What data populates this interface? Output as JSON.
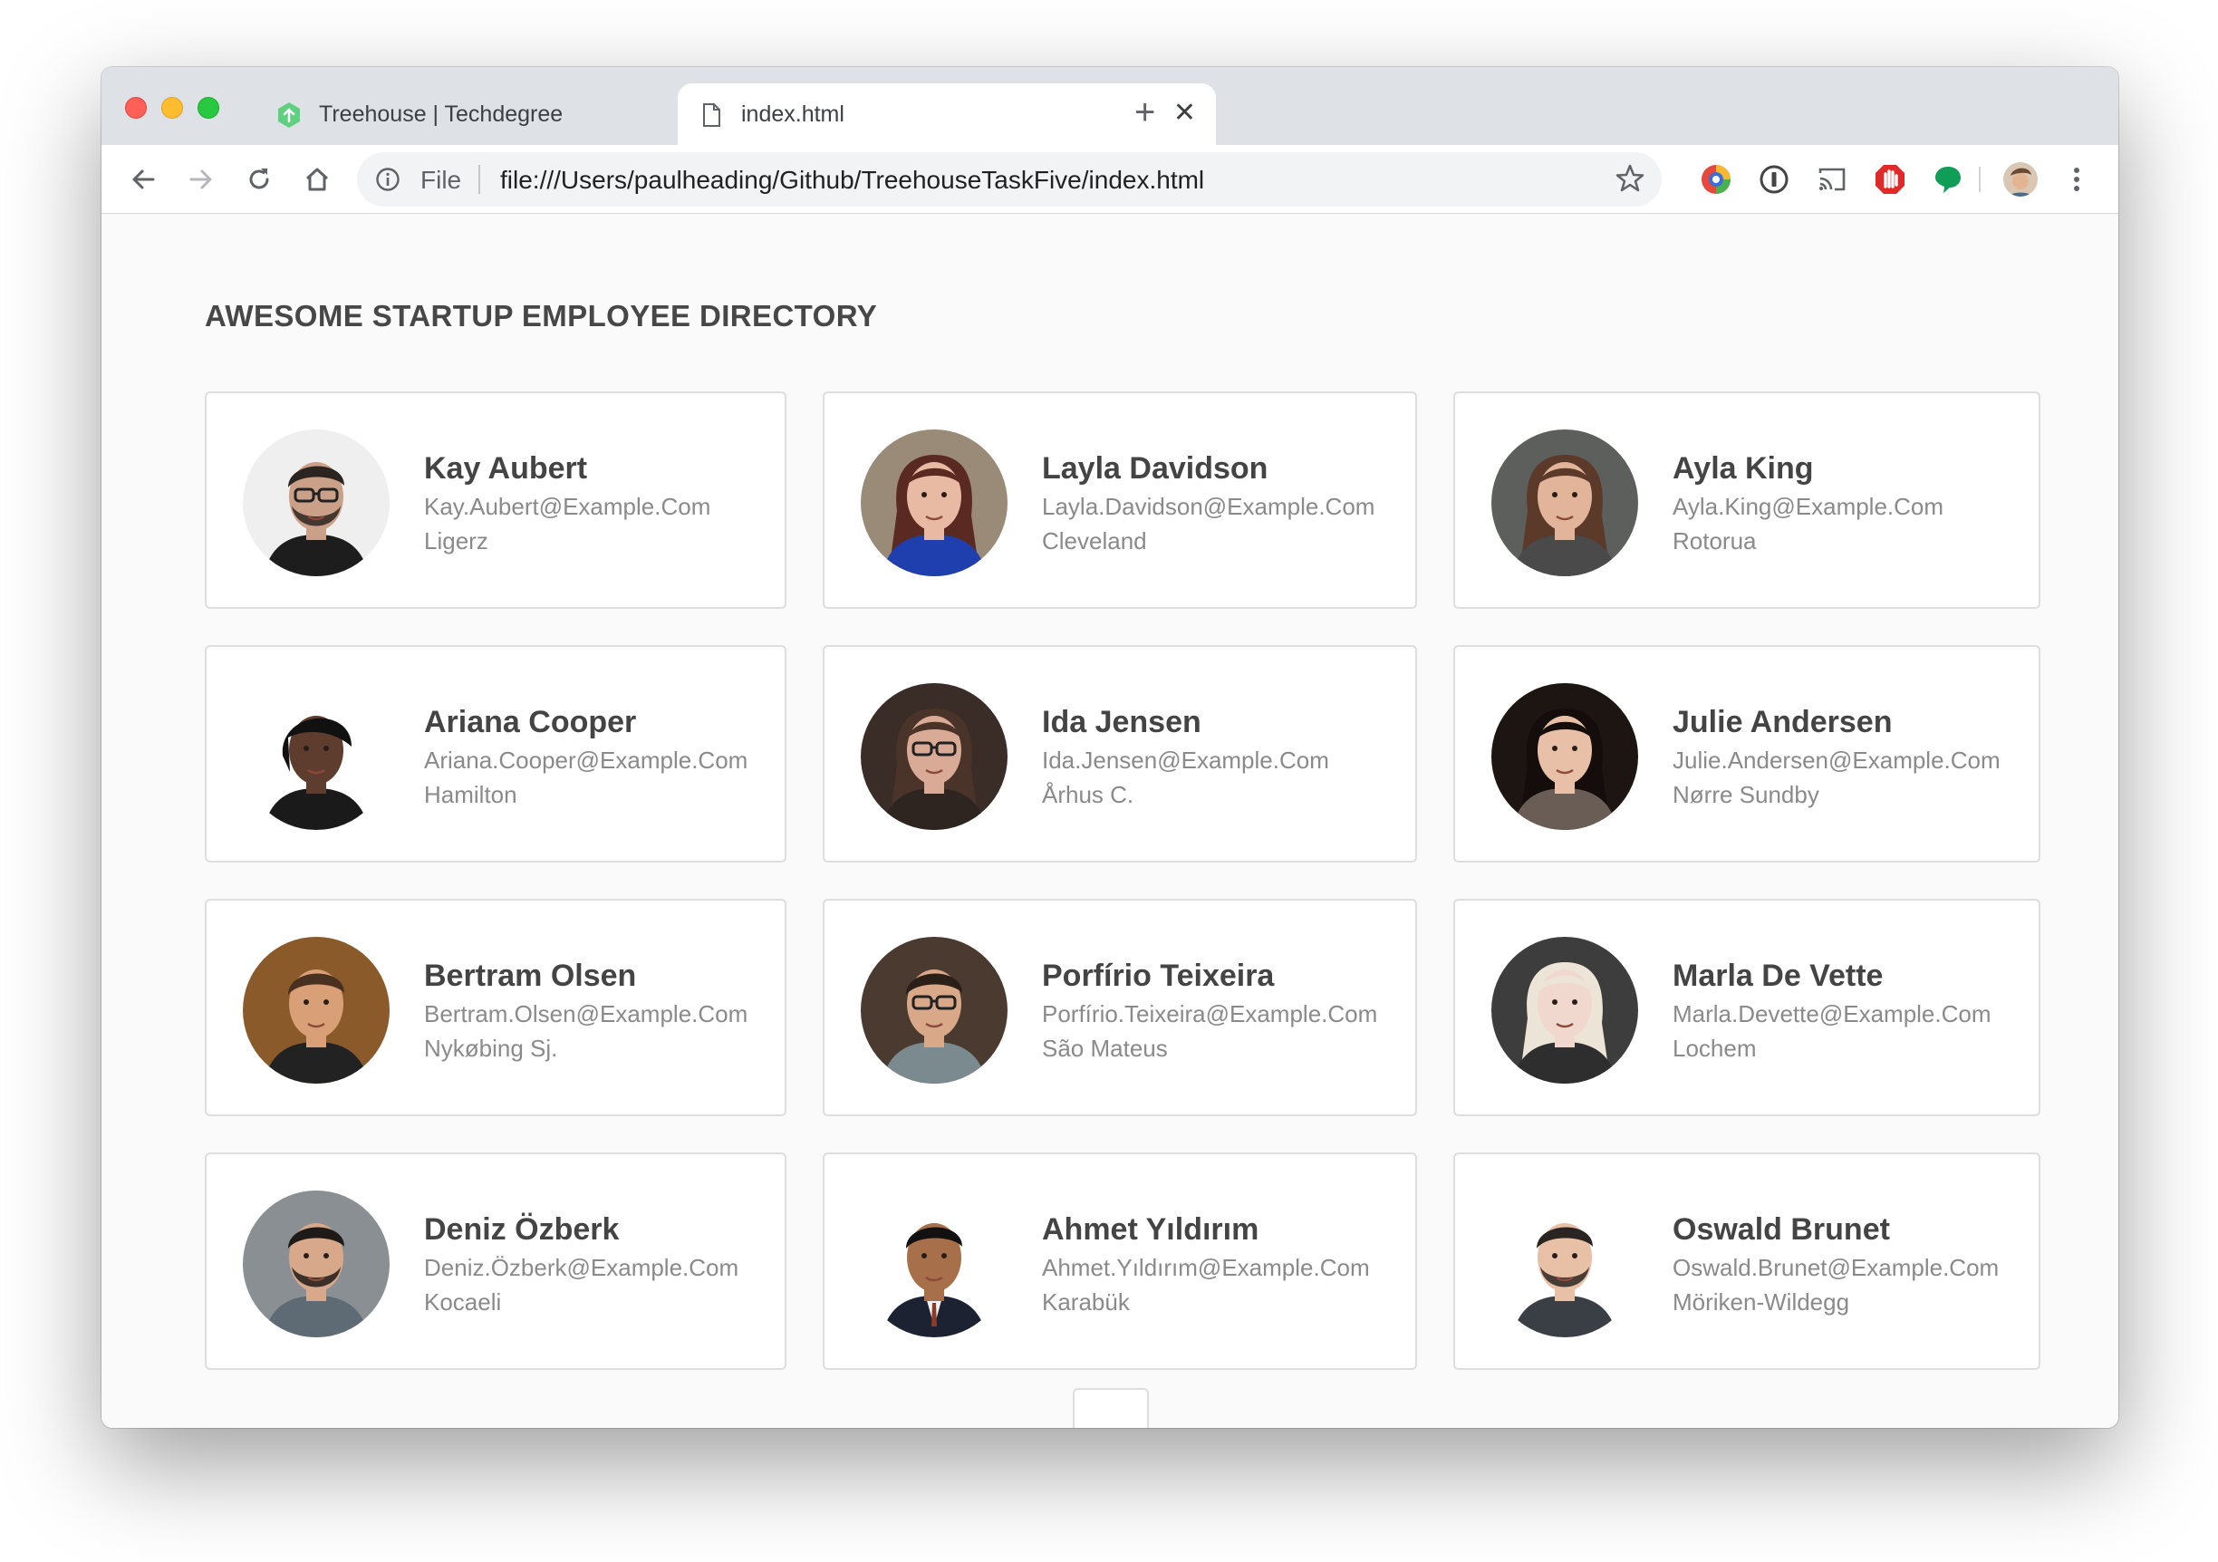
{
  "browser": {
    "tabs": [
      {
        "title": "Treehouse | Techdegree",
        "active": false,
        "icon": "treehouse-favicon"
      },
      {
        "title": "index.html",
        "active": true,
        "icon": "page-icon"
      }
    ],
    "close_glyph": "✕",
    "new_tab_glyph": "+",
    "address": {
      "scheme_label": "File",
      "url": "file:///Users/paulheading/Github/TreehouseTaskFive/index.html"
    }
  },
  "page": {
    "title": "AWESOME STARTUP EMPLOYEE DIRECTORY",
    "employees": [
      {
        "name": "Kay Aubert",
        "email": "Kay.Aubert@Example.Com",
        "city": "Ligerz"
      },
      {
        "name": "Layla Davidson",
        "email": "Layla.Davidson@Example.Com",
        "city": "Cleveland"
      },
      {
        "name": "Ayla King",
        "email": "Ayla.King@Example.Com",
        "city": "Rotorua"
      },
      {
        "name": "Ariana Cooper",
        "email": "Ariana.Cooper@Example.Com",
        "city": "Hamilton"
      },
      {
        "name": "Ida Jensen",
        "email": "Ida.Jensen@Example.Com",
        "city": "Århus C."
      },
      {
        "name": "Julie Andersen",
        "email": "Julie.Andersen@Example.Com",
        "city": "Nørre Sundby"
      },
      {
        "name": "Bertram Olsen",
        "email": "Bertram.Olsen@Example.Com",
        "city": "Nykøbing Sj."
      },
      {
        "name": "Porfírio Teixeira",
        "email": "Porfírio.Teixeira@Example.Com",
        "city": "São Mateus"
      },
      {
        "name": "Marla De Vette",
        "email": "Marla.Devette@Example.Com",
        "city": "Lochem"
      },
      {
        "name": "Deniz Özberk",
        "email": "Deniz.Özberk@Example.Com",
        "city": "Kocaeli"
      },
      {
        "name": "Ahmet Yıldırım",
        "email": "Ahmet.Yıldırım@Example.Com",
        "city": "Karabük"
      },
      {
        "name": "Oswald Brunet",
        "email": "Oswald.Brunet@Example.Com",
        "city": "Möriken-Wildegg"
      }
    ]
  },
  "colors": {
    "bg": "#fafafa",
    "card_border": "#dedede",
    "name": "#444444",
    "detail": "#8a8a8a"
  }
}
